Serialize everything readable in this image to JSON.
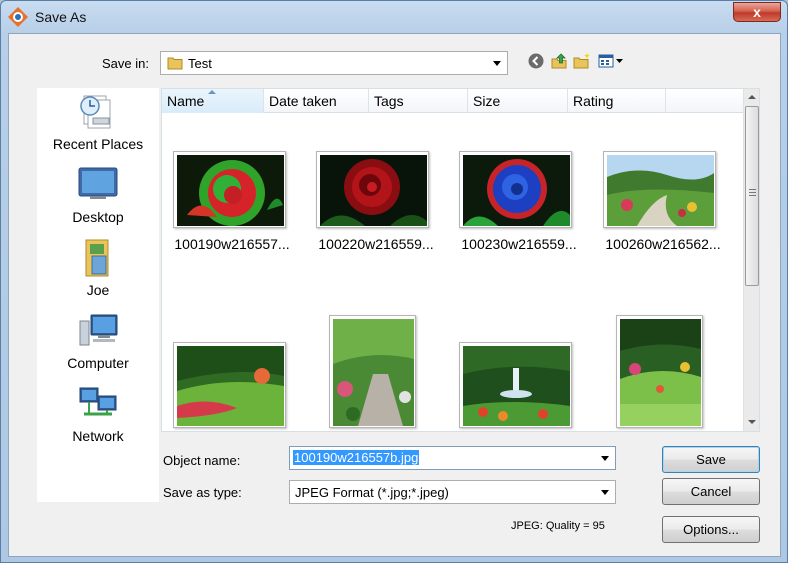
{
  "window": {
    "title": "Save As",
    "close_label": "x"
  },
  "location": {
    "label": "Save in:",
    "value": "Test"
  },
  "places": [
    {
      "label": "Recent Places",
      "icon": "recent-places-icon"
    },
    {
      "label": "Desktop",
      "icon": "desktop-icon"
    },
    {
      "label": "Joe",
      "icon": "user-folder-icon"
    },
    {
      "label": "Computer",
      "icon": "computer-icon"
    },
    {
      "label": "Network",
      "icon": "network-icon"
    }
  ],
  "columns": [
    "Name",
    "Date taken",
    "Tags",
    "Size",
    "Rating"
  ],
  "sorted_column": "Name",
  "files": [
    {
      "name": "100190w216557...",
      "image": "red-green rose"
    },
    {
      "name": "100220w216559...",
      "image": "red rose"
    },
    {
      "name": "100230w216559...",
      "image": "blue rose"
    },
    {
      "name": "100260w216562...",
      "image": "garden"
    },
    {
      "name": "",
      "image": "lawn"
    },
    {
      "name": "",
      "image": "garden path"
    },
    {
      "name": "",
      "image": "fountain"
    },
    {
      "name": "",
      "image": "sunken garden"
    }
  ],
  "form": {
    "object_name_label": "Object name:",
    "object_name_value": "100190w216557b.jpg",
    "type_label": "Save as type:",
    "type_value": "JPEG Format (*.jpg;*.jpeg)"
  },
  "buttons": {
    "save": "Save",
    "cancel": "Cancel",
    "options": "Options..."
  },
  "quality_text": "JPEG: Quality = 95",
  "colors": {
    "selection": "#3399ff",
    "accent": "#3c7fb1",
    "close_button": "#c0392b"
  }
}
